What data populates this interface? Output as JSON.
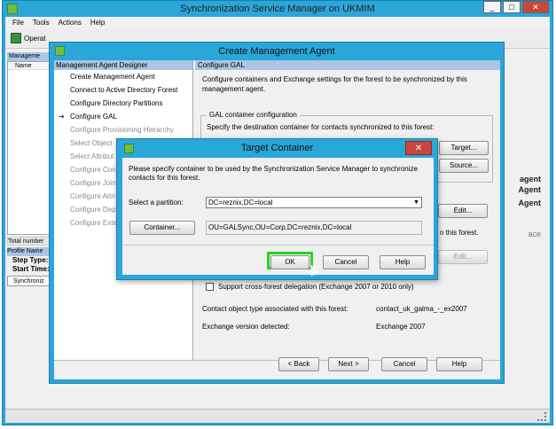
{
  "main_window": {
    "title": "Synchronization Service Manager on UKMIM",
    "menu": [
      "File",
      "Tools",
      "Actions",
      "Help"
    ],
    "toolbar_label": "Operat",
    "left_panel": {
      "header": "Manageme",
      "column": "Name",
      "total": "Total number",
      "profile_header": "Profile Name",
      "step_type": "Step Type:",
      "start_time": "Start Time:",
      "sync_item": "Synchroniz"
    },
    "bg_right_text_1": "agent",
    "bg_right_text_2": "Agent",
    "bg_right_text_3": "Agent",
    "bg_right_text_4": "ace"
  },
  "cma_dialog": {
    "title": "Create Management Agent",
    "nav_header": "Management Agent Designer",
    "nav_items": [
      {
        "label": "Create Management Agent",
        "state": "enabled"
      },
      {
        "label": "Connect to Active Directory Forest",
        "state": "enabled"
      },
      {
        "label": "Configure Directory Partitions",
        "state": "enabled"
      },
      {
        "label": "Configure GAL",
        "state": "current"
      },
      {
        "label": "Configure Provisioning Hierarchy",
        "state": "disabled"
      },
      {
        "label": "Select Object",
        "state": "disabled"
      },
      {
        "label": "Select Attribut",
        "state": "disabled"
      },
      {
        "label": "Configure Conn",
        "state": "disabled"
      },
      {
        "label": "Configure Join",
        "state": "disabled"
      },
      {
        "label": "Configure Attri",
        "state": "disabled"
      },
      {
        "label": "Configure Depr",
        "state": "disabled"
      },
      {
        "label": "Configure Exte",
        "state": "disabled"
      }
    ],
    "main_header": "Configure GAL",
    "description": "Configure containers and Exchange settings for the forest to be synchronized by this management agent.",
    "gal_group_title": "GAL container configuration",
    "gal_group_text": "Specify the destination container for contacts synchronized to this forest:",
    "target_button": "Target...",
    "source_button": "Source...",
    "edit_button_1": "Edit...",
    "edit_button_2": "Edit...",
    "partial_text": "n this forest.",
    "cross_forest_checkbox": "Support cross-forest delegation (Exchange 2007 or 2010 only)",
    "contact_type_label": "Contact object type associated with this forest:",
    "contact_type_value": "contact_uk_galma_-_ex2007",
    "exchange_version_label": "Exchange version detected:",
    "exchange_version_value": "Exchange 2007",
    "back_button": "< Back",
    "next_button": "Next >",
    "cancel_button": "Cancel",
    "help_button": "Help"
  },
  "target_dialog": {
    "title": "Target Container",
    "close_glyph": "✕",
    "instructions": "Please specify container to be used by the Synchronization Service Manager to synchronize contacts for this forest.",
    "partition_label": "Select a partition:",
    "partition_value": "DC=reznix,DC=local",
    "container_button": "Container...",
    "container_value": "OU=GALSync,OU=Corp,DC=reznix,DC=local",
    "ok_button": "OK",
    "cancel_button": "Cancel",
    "help_button": "Help"
  },
  "colors": {
    "title_bar": "#2aa6d9",
    "header_blue": "#aac6e4",
    "highlight_green": "#27d427",
    "close_red": "#c9463d"
  }
}
